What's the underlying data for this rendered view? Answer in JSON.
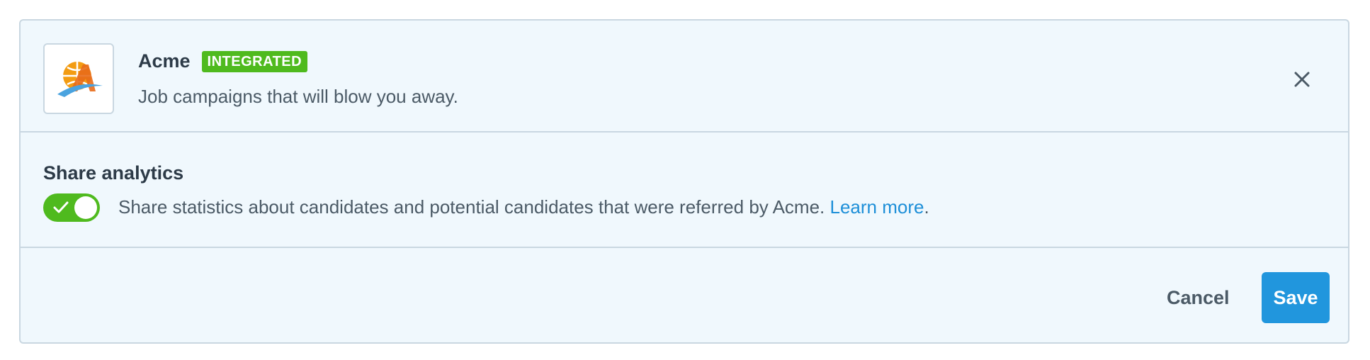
{
  "integration": {
    "name": "Acme",
    "status_badge": "INTEGRATED",
    "tagline": "Job campaigns that will blow you away.",
    "logo_icon": "acme-globe-logo",
    "close_icon": "close-icon"
  },
  "analytics": {
    "title": "Share analytics",
    "toggle_on": true,
    "description": "Share statistics about candidates and potential candidates that were referred by Acme. ",
    "link_label": "Learn more",
    "trailing": "."
  },
  "footer": {
    "cancel_label": "Cancel",
    "save_label": "Save"
  },
  "colors": {
    "badge_green": "#4fba1e",
    "toggle_green": "#4fba1e",
    "link_blue": "#1d8fd8",
    "save_blue": "#2196dd",
    "panel_bg": "#f0f8fd",
    "border": "#c9d7e1"
  }
}
